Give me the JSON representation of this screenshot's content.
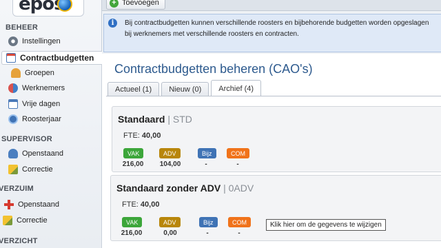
{
  "app": {
    "logo_text": "epos"
  },
  "topbar": {
    "add_label": "Toevoegen"
  },
  "sidebar": {
    "sections": [
      {
        "label": "BEHEER"
      },
      {
        "label": "SUPERVISOR"
      },
      {
        "label": "VERZUIM"
      },
      {
        "label": "VERZICHT"
      }
    ],
    "items": [
      {
        "label": "Instellingen",
        "icon": "gear-icon"
      },
      {
        "label": "Contractbudgetten",
        "icon": "calendar-icon"
      },
      {
        "label": "Groepen",
        "icon": "groups-icon"
      },
      {
        "label": "Werknemers",
        "icon": "users-icon"
      },
      {
        "label": "Vrije dagen",
        "icon": "calendar-days-icon"
      },
      {
        "label": "Roosterjaar",
        "icon": "roster-icon"
      },
      {
        "label": "Openstaand",
        "icon": "person-icon"
      },
      {
        "label": "Correctie",
        "icon": "pencil-icon"
      },
      {
        "label": "Openstaand",
        "icon": "medical-cross-icon"
      },
      {
        "label": "Correctie",
        "icon": "pencil-icon"
      }
    ]
  },
  "info": {
    "line1": "Bij contractbudgetten kunnen verschillende roosters en bijbehorende budgetten worden opgeslagen",
    "line2": "bij werknemers met verschillende roosters en contracten."
  },
  "main": {
    "title": "Contractbudgetten beheren (CAO's)",
    "tabs": [
      {
        "label": "Actueel (1)"
      },
      {
        "label": "Nieuw (0)"
      },
      {
        "label": "Archief (4)"
      }
    ]
  },
  "cards": [
    {
      "name": "Standaard",
      "separator": "|",
      "code": "STD",
      "fte_label": "FTE:",
      "fte_value": "40,00",
      "badges": [
        {
          "label": "VAK",
          "value": "216,00",
          "color": "#3ca63a"
        },
        {
          "label": "ADV",
          "value": "104,00",
          "color": "#b8860b"
        },
        {
          "label": "Bijz",
          "value": "-",
          "color": "#3f73b5"
        },
        {
          "label": "COM",
          "value": "-",
          "color": "#f0731a"
        }
      ]
    },
    {
      "name": "Standaard zonder ADV",
      "separator": "|",
      "code": "0ADV",
      "fte_label": "FTE:",
      "fte_value": "40,00",
      "badges": [
        {
          "label": "VAK",
          "value": "216,00",
          "color": "#3ca63a"
        },
        {
          "label": "ADV",
          "value": "0,00",
          "color": "#b8860b"
        },
        {
          "label": "Bijz",
          "value": "-",
          "color": "#3f73b5"
        },
        {
          "label": "COM",
          "value": "-",
          "color": "#f0731a"
        }
      ]
    }
  ],
  "tooltip": {
    "text": "Klik hier om de gegevens te wijzigen"
  }
}
